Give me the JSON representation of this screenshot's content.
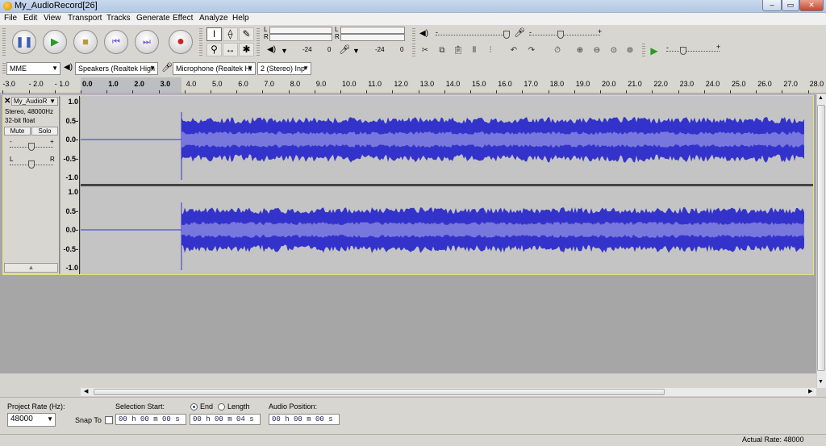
{
  "window": {
    "title": "My_AudioRecord[26]",
    "minimize": "–",
    "maximize": "▭",
    "close": "✕"
  },
  "menu": [
    "File",
    "Edit",
    "View",
    "Transport",
    "Tracks",
    "Generate",
    "Effect",
    "Analyze",
    "Help"
  ],
  "transport": {
    "pause": "❚❚",
    "play": "▶",
    "stop": "■",
    "skip_start": "⏮",
    "skip_end": "⏭",
    "record": "●"
  },
  "meters": {
    "playback_L": "L",
    "playback_R": "R",
    "record_L": "L",
    "record_R": "R",
    "db_minus24_a": "-24",
    "zero": "0",
    "db_minus24_b": "-24",
    "zero_b": "0"
  },
  "device": {
    "host": "MME",
    "speakers": "Speakers (Realtek High",
    "microphone": "Microphone (Realtek Hi",
    "channels": "2 (Stereo) Inp"
  },
  "ruler": {
    "ticks": [
      "-3.0",
      "- 2.0",
      "- 1.0",
      "0.0",
      "1.0",
      "2.0",
      "3.0",
      "4.0",
      "5.0",
      "6.0",
      "7.0",
      "8.0",
      "9.0",
      "10.0",
      "11.0",
      "12.0",
      "13.0",
      "14.0",
      "15.0",
      "16.0",
      "17.0",
      "18.0",
      "19.0",
      "20.0",
      "21.0",
      "22.0",
      "23.0",
      "24.0",
      "25.0",
      "26.0",
      "27.0",
      "28.0"
    ]
  },
  "track": {
    "name": "My_AudioR",
    "info1": "Stereo, 48000Hz",
    "info2": "32-bit float",
    "mute": "Mute",
    "solo": "Solo",
    "gain_minus": "-",
    "gain_plus": "+",
    "pan_L": "L",
    "pan_R": "R",
    "vlabels": [
      "1.0",
      "0.5-",
      "0.0-",
      "-0.5-",
      "-1.0"
    ],
    "wave_color": "#3333cc",
    "wave_light": "#7777dd",
    "audio_start_seconds": 4.0
  },
  "selection": {
    "project_rate_label": "Project Rate (Hz):",
    "project_rate": "48000",
    "snap_to": "Snap To",
    "selection_start_label": "Selection Start:",
    "end_label": "End",
    "length_label": "Length",
    "audio_position_label": "Audio Position:",
    "start_time": "00 h 00 m 00 s",
    "end_time": "00 h 00 m 04 s",
    "audio_position": "00 h 00 m 00 s"
  },
  "status": {
    "actual_rate": "Actual Rate: 48000"
  }
}
